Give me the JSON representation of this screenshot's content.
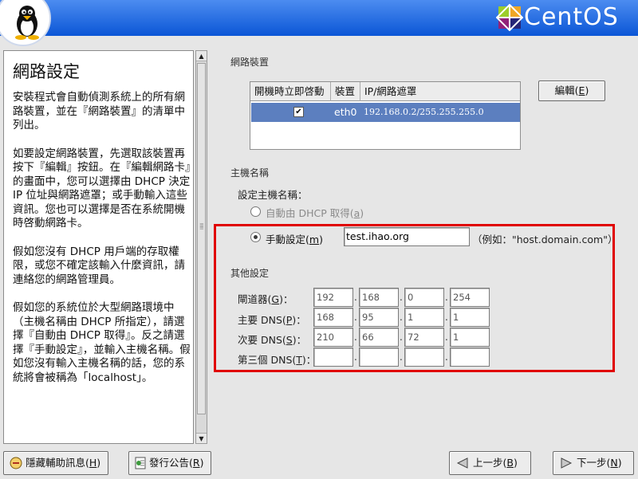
{
  "header": {
    "logo_text": "CentOS"
  },
  "help": {
    "title": "網路設定",
    "paragraphs": [
      "安裝程式會自動偵測系統上的所有網路裝置，並在『網路裝置』的清單中列出。",
      "如要設定網路裝置，先選取該裝置再按下『編輯』按鈕。在『編輯網路卡』的畫面中，您可以選擇由 DHCP 決定 IP 位址與網路遮罩；或手動輸入這些資訊。您也可以選擇是否在系統開機時啓動網路卡。",
      "假如您沒有 DHCP 用戶端的存取權限，或您不確定該輸入什麼資訊，請連絡您的網路管理員。",
      "假如您的系統位於大型網路環境中（主機名稱由 DHCP 所指定），請選擇『自動由 DHCP 取得』。反之請選擇『手動設定』，並輸入主機名稱。假如您沒有輸入主機名稱的話，您的系統將會被稱為「localhost」。"
    ]
  },
  "network_devices": {
    "section_label": "網路裝置",
    "columns": [
      "開機時立即啓動",
      "裝置",
      "IP/網路遮罩"
    ],
    "rows": [
      {
        "active": "✔",
        "device": "eth0",
        "ip_mask": "192.168.0.2/255.255.255.0"
      }
    ],
    "edit_button": {
      "text": "編輯(",
      "key": "E",
      "close": ")"
    }
  },
  "hostname": {
    "section_label": "主機名稱",
    "set_label": "設定主機名稱：",
    "dhcp_option": {
      "text": "自動由 DHCP 取得(",
      "key": "a",
      "close": ")"
    },
    "manual_option": {
      "text": "手動設定(",
      "key": "m",
      "close": ")"
    },
    "manual_value": "test.ihao.org",
    "example": "（例如：\"host.domain.com\"）"
  },
  "misc": {
    "section_label": "其他設定",
    "rows": [
      {
        "label": "閘道器(",
        "key": "G",
        "close": ")：",
        "octets": [
          "192",
          "168",
          "0",
          "254"
        ]
      },
      {
        "label": "主要 DNS(",
        "key": "P",
        "close": ")：",
        "octets": [
          "168",
          "95",
          "1",
          "1"
        ]
      },
      {
        "label": "次要 DNS(",
        "key": "S",
        "close": ")：",
        "octets": [
          "210",
          "66",
          "72",
          "1"
        ]
      },
      {
        "label": "第三個 DNS(",
        "key": "T",
        "close": ")：",
        "octets": [
          "",
          "",
          "",
          ""
        ]
      }
    ]
  },
  "footer": {
    "hide_help": {
      "text": "隱藏輔助訊息(",
      "key": "H",
      "close": ")"
    },
    "release_notes": {
      "text": "發行公告(",
      "key": "R",
      "close": ")"
    },
    "back": {
      "text": "上一步(",
      "key": "B",
      "close": ")"
    },
    "next": {
      "text": "下一步(",
      "key": "N",
      "close": ")"
    }
  },
  "colors": {
    "header_blue": "#0b56d6",
    "selection": "#5c7fbf",
    "highlight_box": "#e00000"
  }
}
